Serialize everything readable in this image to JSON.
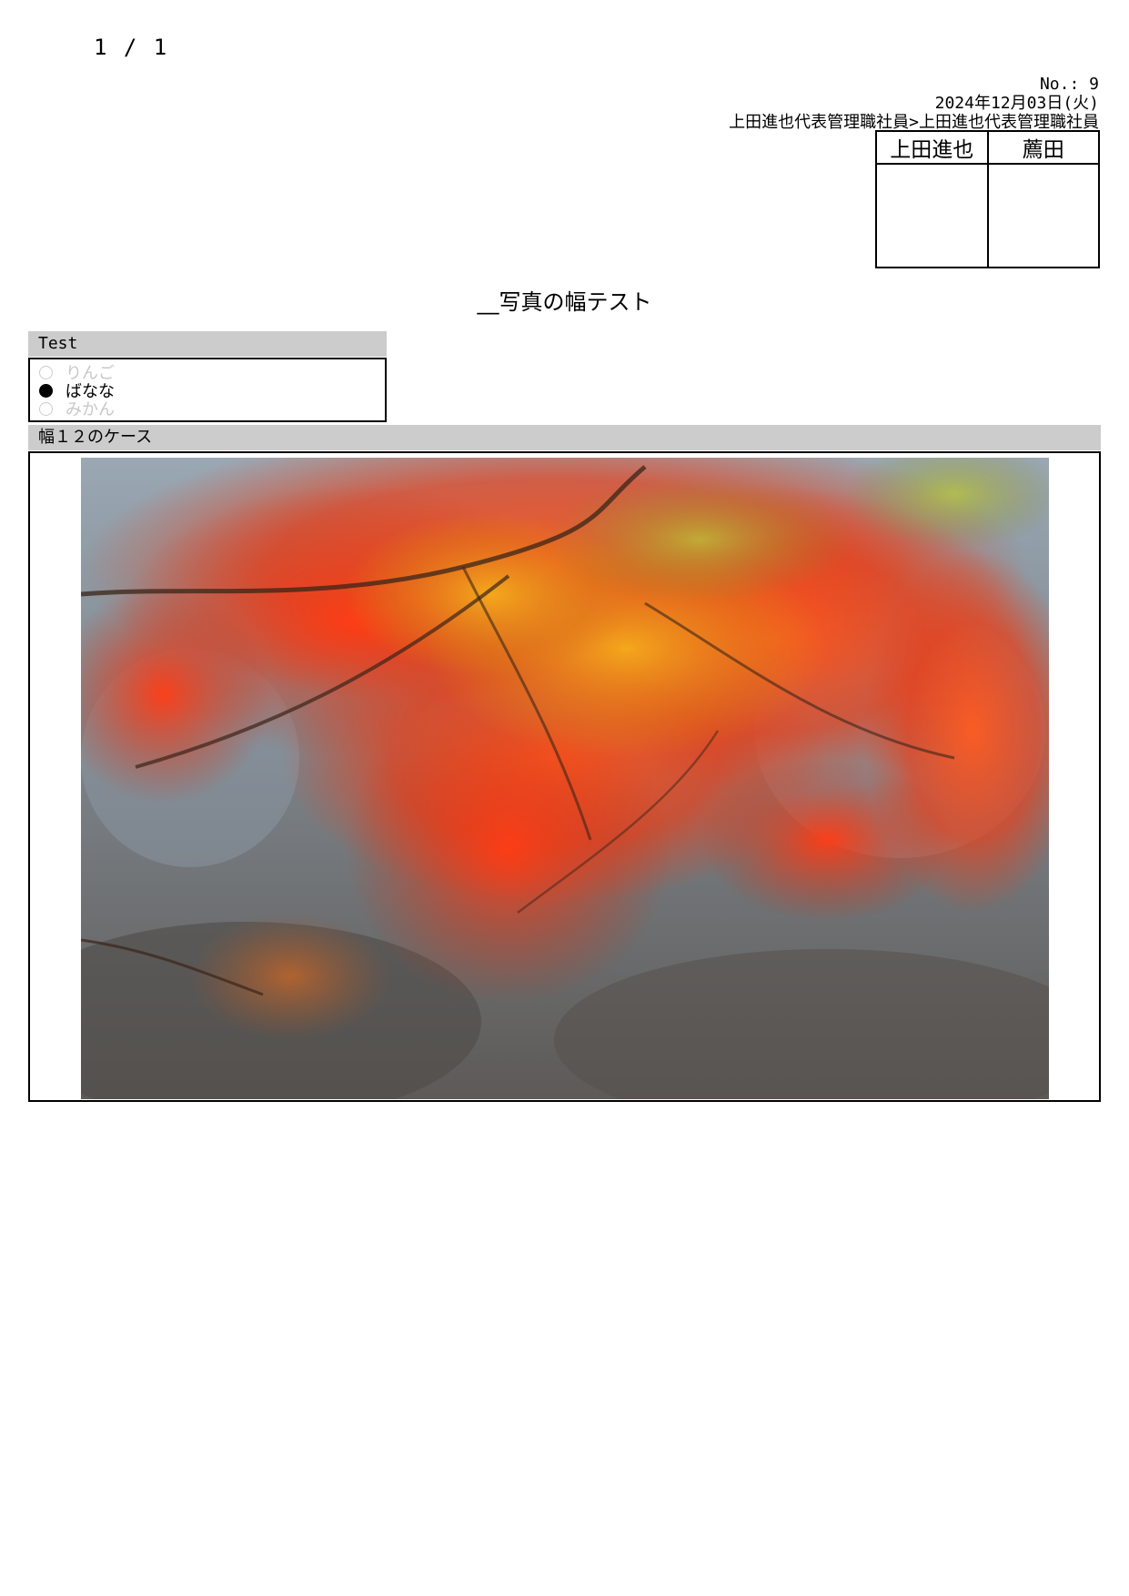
{
  "page_counter": "1 / 1",
  "header": {
    "number": "No.: 9",
    "date": "2024年12月03日(火)",
    "route": "上田進也代表管理職社員>上田進也代表管理職社員"
  },
  "approvals": {
    "columns": [
      "上田進也",
      "薦田"
    ]
  },
  "title": "__写真の幅テスト",
  "test_section": {
    "label": "Test",
    "options": [
      {
        "label": "りんご",
        "selected": false
      },
      {
        "label": "ばなな",
        "selected": true
      },
      {
        "label": "みかん",
        "selected": false
      }
    ]
  },
  "photo_section": {
    "label": "幅１２のケース",
    "image_alt": "red-maple-leaves-photo"
  }
}
